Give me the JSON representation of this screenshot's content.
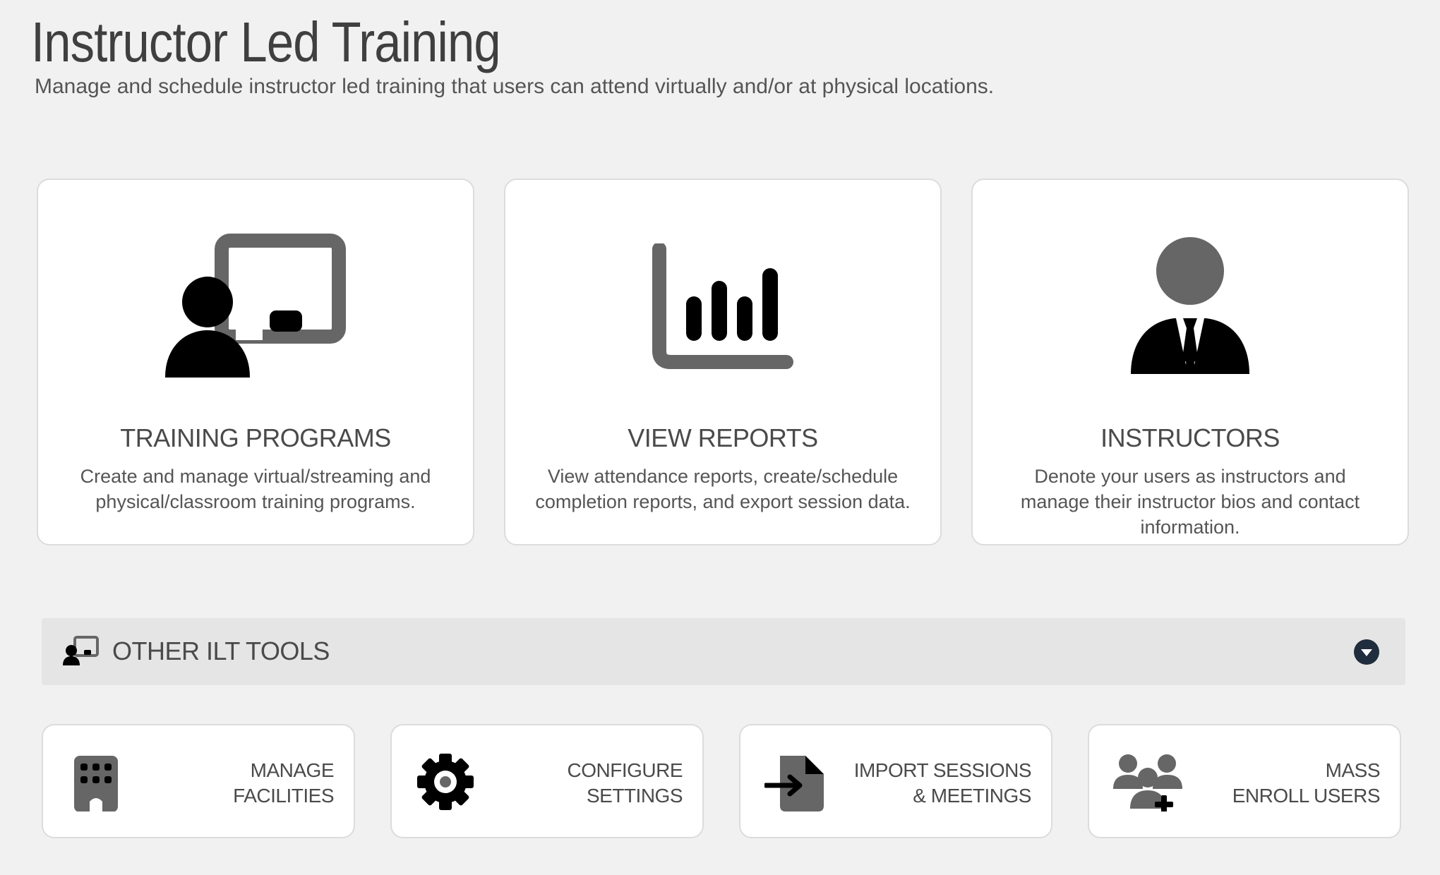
{
  "page": {
    "title": "Instructor Led Training",
    "subtitle": "Manage and schedule instructor led training that users can attend virtually and/or at physical locations."
  },
  "cards": [
    {
      "icon": "chalkboard-teacher-icon",
      "title": "TRAINING PROGRAMS",
      "description": "Create and manage virtual/streaming and physical/classroom training programs."
    },
    {
      "icon": "chart-bar-icon",
      "title": "VIEW REPORTS",
      "description": "View attendance reports, create/schedule completion reports, and export session data."
    },
    {
      "icon": "user-tie-icon",
      "title": "INSTRUCTORS",
      "description": "Denote your users as instructors and manage their instructor bios and contact information."
    }
  ],
  "tools_section": {
    "icon": "chalkboard-teacher-icon",
    "title": "OTHER ILT TOOLS",
    "toggle_icon": "chevron-down-circle-icon"
  },
  "tools": [
    {
      "icon": "building-icon",
      "line1": "MANAGE",
      "line2": "FACILITIES"
    },
    {
      "icon": "gear-icon",
      "line1": "CONFIGURE",
      "line2": "SETTINGS"
    },
    {
      "icon": "file-import-icon",
      "line1": "IMPORT SESSIONS",
      "line2": "& MEETINGS"
    },
    {
      "icon": "users-plus-icon",
      "line1": "MASS",
      "line2": "ENROLL USERS"
    }
  ],
  "colors": {
    "background": "#f1f1f1",
    "card": "#ffffff",
    "icon_dark": "#000000",
    "icon_gray": "#666666",
    "bar": "#e5e5e5",
    "chevron_circle": "#1f2d3d"
  }
}
